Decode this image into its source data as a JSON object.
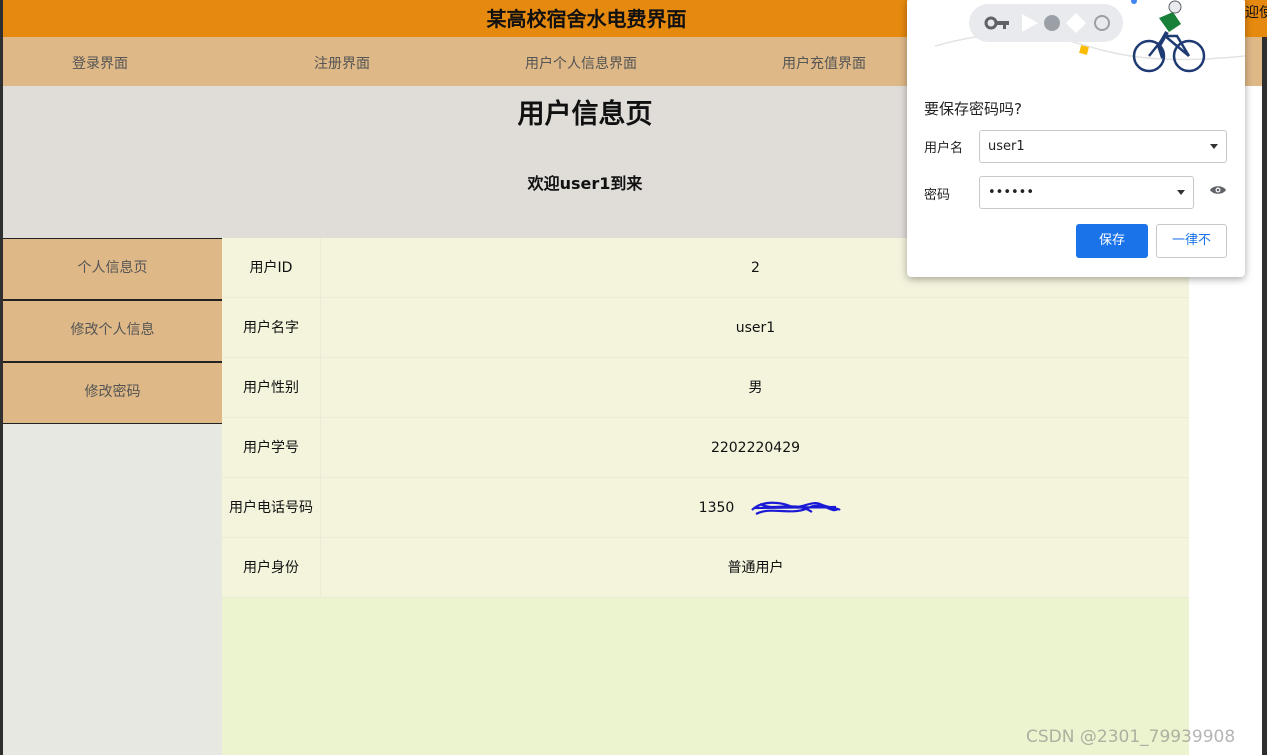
{
  "banner": {
    "title": "某高校宿舍水电费界面",
    "welcome_partial": "迎使"
  },
  "nav": {
    "items": [
      "登录界面",
      "注册界面",
      "用户个人信息界面",
      "用户充值界面"
    ]
  },
  "header": {
    "heading": "用户信息页",
    "welcome": "欢迎user1到来"
  },
  "sidebar": {
    "items": [
      "个人信息页",
      "修改个人信息",
      "修改密码"
    ]
  },
  "table": {
    "rows": [
      {
        "label": "用户ID",
        "value": "2"
      },
      {
        "label": "用户名字",
        "value": "user1"
      },
      {
        "label": "用户性别",
        "value": "男"
      },
      {
        "label": "用户学号",
        "value": "2202220429"
      },
      {
        "label": "用户电话号码",
        "value": "1350"
      },
      {
        "label": "用户身份",
        "value": "普通用户"
      }
    ]
  },
  "popup": {
    "title": "要保存密码吗?",
    "username_label": "用户名",
    "username_value": "user1",
    "password_label": "密码",
    "password_value": "••••••",
    "save_button": "保存",
    "never_button": "一律不"
  },
  "watermark": "CSDN @2301_79939908",
  "colors": {
    "banner": "#e6890f",
    "nav": "#deb887",
    "primary_button": "#1a73e8"
  }
}
